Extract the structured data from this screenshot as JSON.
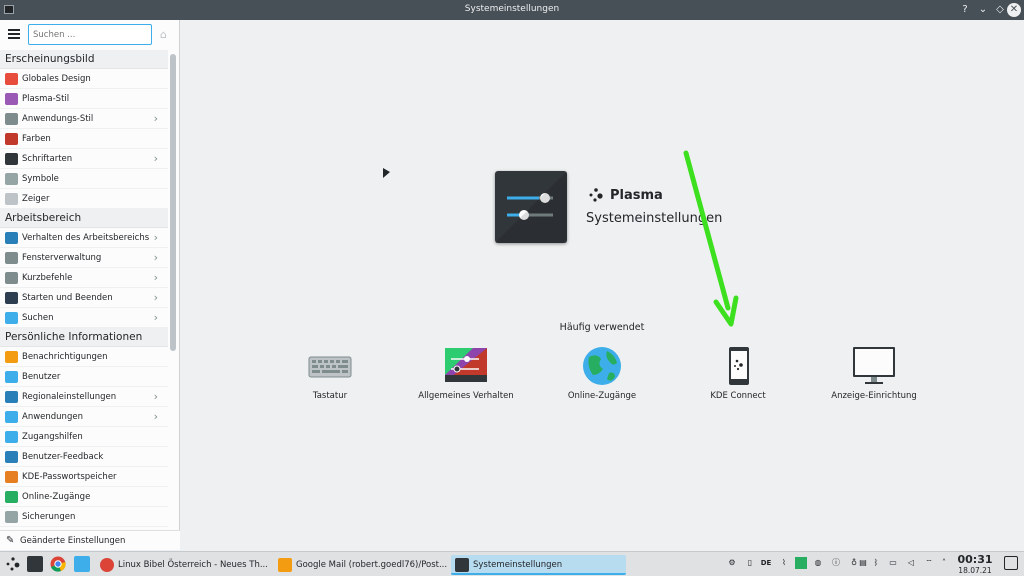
{
  "window": {
    "title": "Systemeinstellungen",
    "controls": {
      "help": "?",
      "minimize": "⌄",
      "maximize": "◇",
      "close": "✕"
    }
  },
  "sidebar": {
    "search_placeholder": "Suchen ...",
    "categories": [
      {
        "label": "Erscheinungsbild",
        "items": [
          {
            "label": "Globales Design",
            "icon": "global-design-icon",
            "color": "#e74c3c",
            "submenu": false
          },
          {
            "label": "Plasma-Stil",
            "icon": "plasma-style-icon",
            "color": "#9b59b6",
            "submenu": false
          },
          {
            "label": "Anwendungs-Stil",
            "icon": "app-style-icon",
            "color": "#7f8c8d",
            "submenu": true
          },
          {
            "label": "Farben",
            "icon": "colors-icon",
            "color": "#c0392b",
            "submenu": false
          },
          {
            "label": "Schriftarten",
            "icon": "fonts-icon",
            "color": "#31363b",
            "submenu": true
          },
          {
            "label": "Symbole",
            "icon": "symbols-icon",
            "color": "#95a5a6",
            "submenu": false
          },
          {
            "label": "Zeiger",
            "icon": "pointer-icon",
            "color": "#bdc3c7",
            "submenu": false
          }
        ]
      },
      {
        "label": "Arbeitsbereich",
        "items": [
          {
            "label": "Verhalten des Arbeitsbereichs",
            "icon": "workspace-behavior-icon",
            "color": "#2980b9",
            "submenu": true
          },
          {
            "label": "Fensterverwaltung",
            "icon": "window-management-icon",
            "color": "#7f8c8d",
            "submenu": true
          },
          {
            "label": "Kurzbefehle",
            "icon": "shortcuts-icon",
            "color": "#7f8c8d",
            "submenu": true
          },
          {
            "label": "Starten und Beenden",
            "icon": "startup-shutdown-icon",
            "color": "#2c3e50",
            "submenu": true
          },
          {
            "label": "Suchen",
            "icon": "search-settings-icon",
            "color": "#3daee9",
            "submenu": true
          }
        ]
      },
      {
        "label": "Persönliche Informationen",
        "items": [
          {
            "label": "Benachrichtigungen",
            "icon": "notifications-icon",
            "color": "#f39c12",
            "submenu": false
          },
          {
            "label": "Benutzer",
            "icon": "users-icon",
            "color": "#3daee9",
            "submenu": false
          },
          {
            "label": "Regionaleinstellungen",
            "icon": "regional-settings-icon",
            "color": "#2980b9",
            "submenu": true
          },
          {
            "label": "Anwendungen",
            "icon": "applications-icon",
            "color": "#3daee9",
            "submenu": true
          },
          {
            "label": "Zugangshilfen",
            "icon": "accessibility-icon",
            "color": "#3daee9",
            "submenu": false
          },
          {
            "label": "Benutzer-Feedback",
            "icon": "user-feedback-icon",
            "color": "#2980b9",
            "submenu": false
          },
          {
            "label": "KDE-Passwortspeicher",
            "icon": "password-storage-icon",
            "color": "#e67e22",
            "submenu": false
          },
          {
            "label": "Online-Zugänge",
            "icon": "online-accounts-icon",
            "color": "#27ae60",
            "submenu": false
          },
          {
            "label": "Sicherungen",
            "icon": "backups-icon",
            "color": "#95a5a6",
            "submenu": false
          }
        ]
      }
    ],
    "highlight_changes": "Geänderte Einstellungen hervorheben"
  },
  "main": {
    "brand": "Plasma",
    "subtitle": "Systemeinstellungen",
    "frequent_title": "Häufig verwendet",
    "frequent": [
      {
        "label": "Tastatur",
        "icon": "keyboard-icon"
      },
      {
        "label": "Allgemeines Verhalten",
        "icon": "general-behavior-icon"
      },
      {
        "label": "Online-Zugänge",
        "icon": "globe-icon"
      },
      {
        "label": "KDE Connect",
        "icon": "phone-icon"
      },
      {
        "label": "Anzeige-Einrichtung",
        "icon": "monitor-icon"
      }
    ],
    "annotation_color": "#3ce01e"
  },
  "taskbar": {
    "tasks": [
      {
        "label": "Linux Bibel Österreich - Neues Th...",
        "icon": "chrome-icon",
        "active": false
      },
      {
        "label": "Google Mail (robert.goedl76)/Post...",
        "icon": "mail-icon",
        "active": false
      },
      {
        "label": "Systemeinstellungen",
        "icon": "settings-icon",
        "active": true
      }
    ],
    "tray_lang": "DE",
    "time": "00:31",
    "date": "18.07.21"
  }
}
